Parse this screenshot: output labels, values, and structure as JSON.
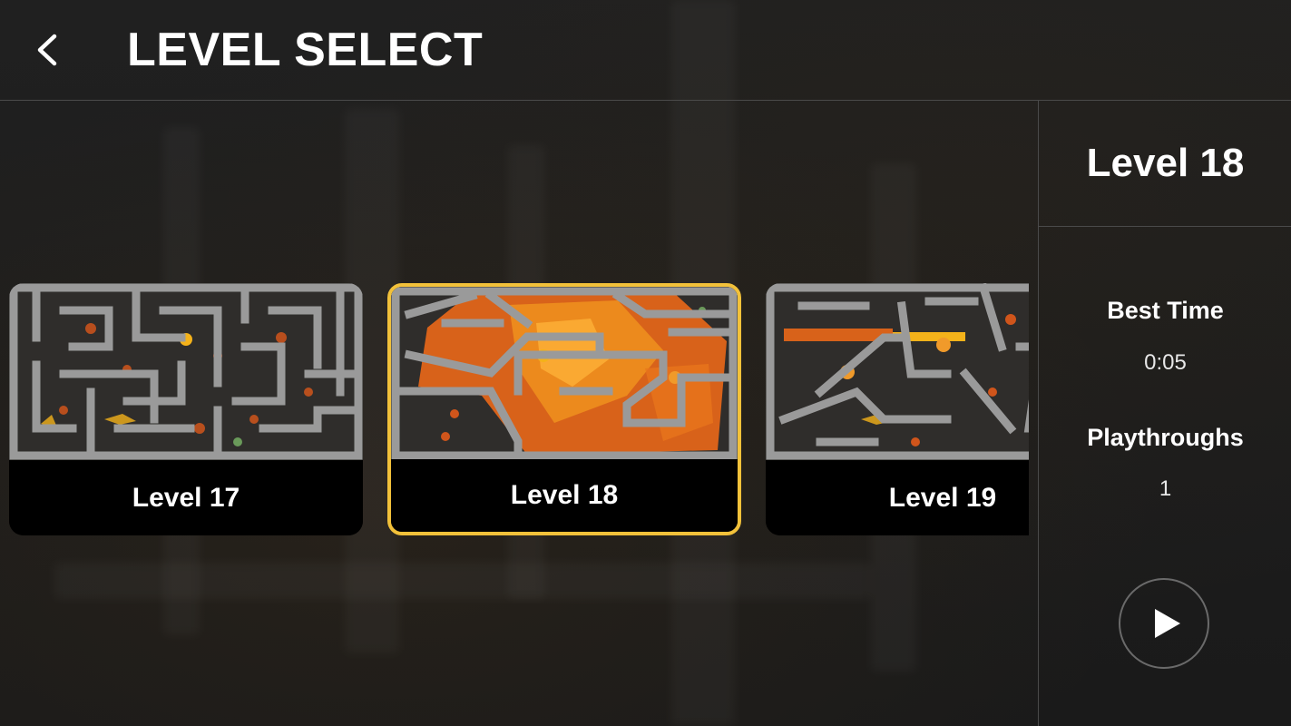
{
  "header": {
    "title": "LEVEL SELECT",
    "back_icon": "chevron-left-icon"
  },
  "levels": [
    {
      "label": "Level 17",
      "selected": false
    },
    {
      "label": "Level 18",
      "selected": true
    },
    {
      "label": "Level 19",
      "selected": false
    }
  ],
  "details": {
    "title": "Level 18",
    "best_time_label": "Best Time",
    "best_time_value": "0:05",
    "playthroughs_label": "Playthroughs",
    "playthroughs_value": "1",
    "play_icon": "play-icon"
  },
  "colors": {
    "accent": "#f2c13a",
    "lava": "#e8741a",
    "stone": "#9a9a9a",
    "background": "#1d1d1d"
  }
}
